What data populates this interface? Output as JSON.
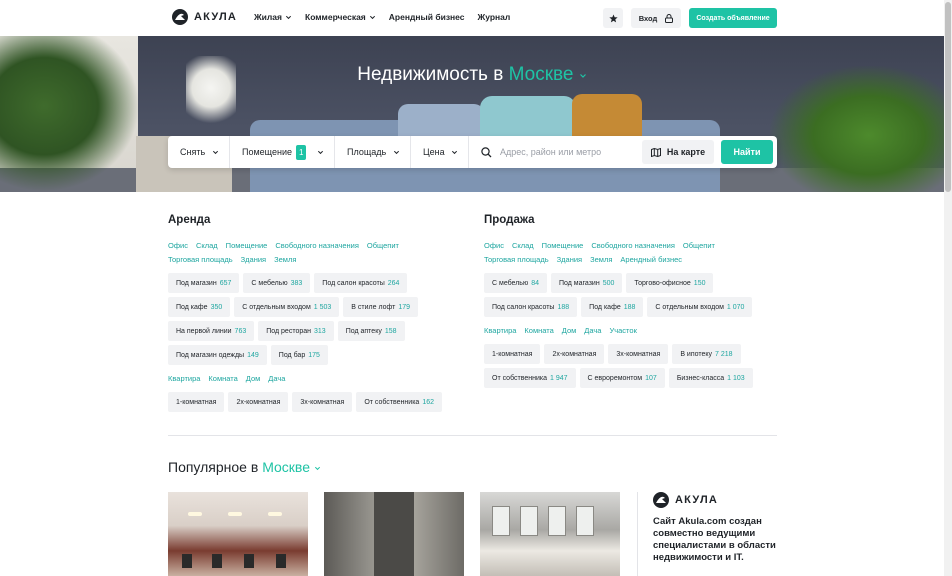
{
  "header": {
    "logo_text": "АКУЛА",
    "nav": [
      {
        "label": "Жилая",
        "has_dropdown": true
      },
      {
        "label": "Коммерческая",
        "has_dropdown": true
      },
      {
        "label": "Арендный бизнес",
        "has_dropdown": false
      },
      {
        "label": "Журнал",
        "has_dropdown": false
      }
    ],
    "login_label": "Вход",
    "create_label": "Создать объявление"
  },
  "hero": {
    "title_prefix": "Недвижимость в",
    "city": "Москве"
  },
  "search": {
    "deal": "Снять",
    "type": "Помещение",
    "type_count": "1",
    "area": "Площадь",
    "price": "Цена",
    "address_placeholder": "Адрес, район или метро",
    "map_label": "На карте",
    "find_label": "Найти"
  },
  "rent": {
    "title": "Аренда",
    "links": [
      "Офис",
      "Склад",
      "Помещение",
      "Свободного назначения",
      "Общепит",
      "Торговая площадь",
      "Здания",
      "Земля"
    ],
    "tags": [
      {
        "label": "Под магазин",
        "count": "657"
      },
      {
        "label": "С мебелью",
        "count": "383"
      },
      {
        "label": "Под салон красоты",
        "count": "264"
      },
      {
        "label": "Под кафе",
        "count": "350"
      },
      {
        "label": "С отдельным входом",
        "count": "1 503"
      },
      {
        "label": "В стиле лофт",
        "count": "179"
      },
      {
        "label": "На первой линии",
        "count": "763"
      },
      {
        "label": "Под ресторан",
        "count": "313"
      },
      {
        "label": "Под аптеку",
        "count": "158"
      },
      {
        "label": "Под магазин одежды",
        "count": "149"
      },
      {
        "label": "Под бар",
        "count": "175"
      }
    ],
    "links2": [
      "Квартира",
      "Комната",
      "Дом",
      "Дача"
    ],
    "tags2": [
      {
        "label": "1-комнатная",
        "count": ""
      },
      {
        "label": "2х-комнатная",
        "count": ""
      },
      {
        "label": "3х-комнатная",
        "count": ""
      },
      {
        "label": "От собственника",
        "count": "162"
      }
    ]
  },
  "sale": {
    "title": "Продажа",
    "links": [
      "Офис",
      "Склад",
      "Помещение",
      "Свободного назначения",
      "Общепит",
      "Торговая площадь",
      "Здания",
      "Земля",
      "Арендный бизнес"
    ],
    "tags": [
      {
        "label": "С мебелью",
        "count": "84"
      },
      {
        "label": "Под магазин",
        "count": "500"
      },
      {
        "label": "Торгово-офисное",
        "count": "150"
      },
      {
        "label": "Под салон красоты",
        "count": "188"
      },
      {
        "label": "Под кафе",
        "count": "188"
      },
      {
        "label": "С отдельным входом",
        "count": "1 070"
      }
    ],
    "links2": [
      "Квартира",
      "Комната",
      "Дом",
      "Дача",
      "Участок"
    ],
    "tags2": [
      {
        "label": "1-комнатная",
        "count": ""
      },
      {
        "label": "2х-комнатная",
        "count": ""
      },
      {
        "label": "3х-комнатная",
        "count": ""
      },
      {
        "label": "В ипотеку",
        "count": "7 218"
      },
      {
        "label": "От собственника",
        "count": "1 947"
      },
      {
        "label": "С евроремонтом",
        "count": "107"
      },
      {
        "label": "Бизнес-класса",
        "count": "1 103"
      }
    ]
  },
  "popular": {
    "title_prefix": "Популярное в",
    "city": "Москве"
  },
  "promo": {
    "logo_text": "АКУЛА",
    "text": "Сайт Akula.com создан совместно ведущими специалистами в области недвижимости и IT."
  },
  "colors": {
    "accent": "#1ec3a5",
    "link": "#1ea6a0"
  }
}
